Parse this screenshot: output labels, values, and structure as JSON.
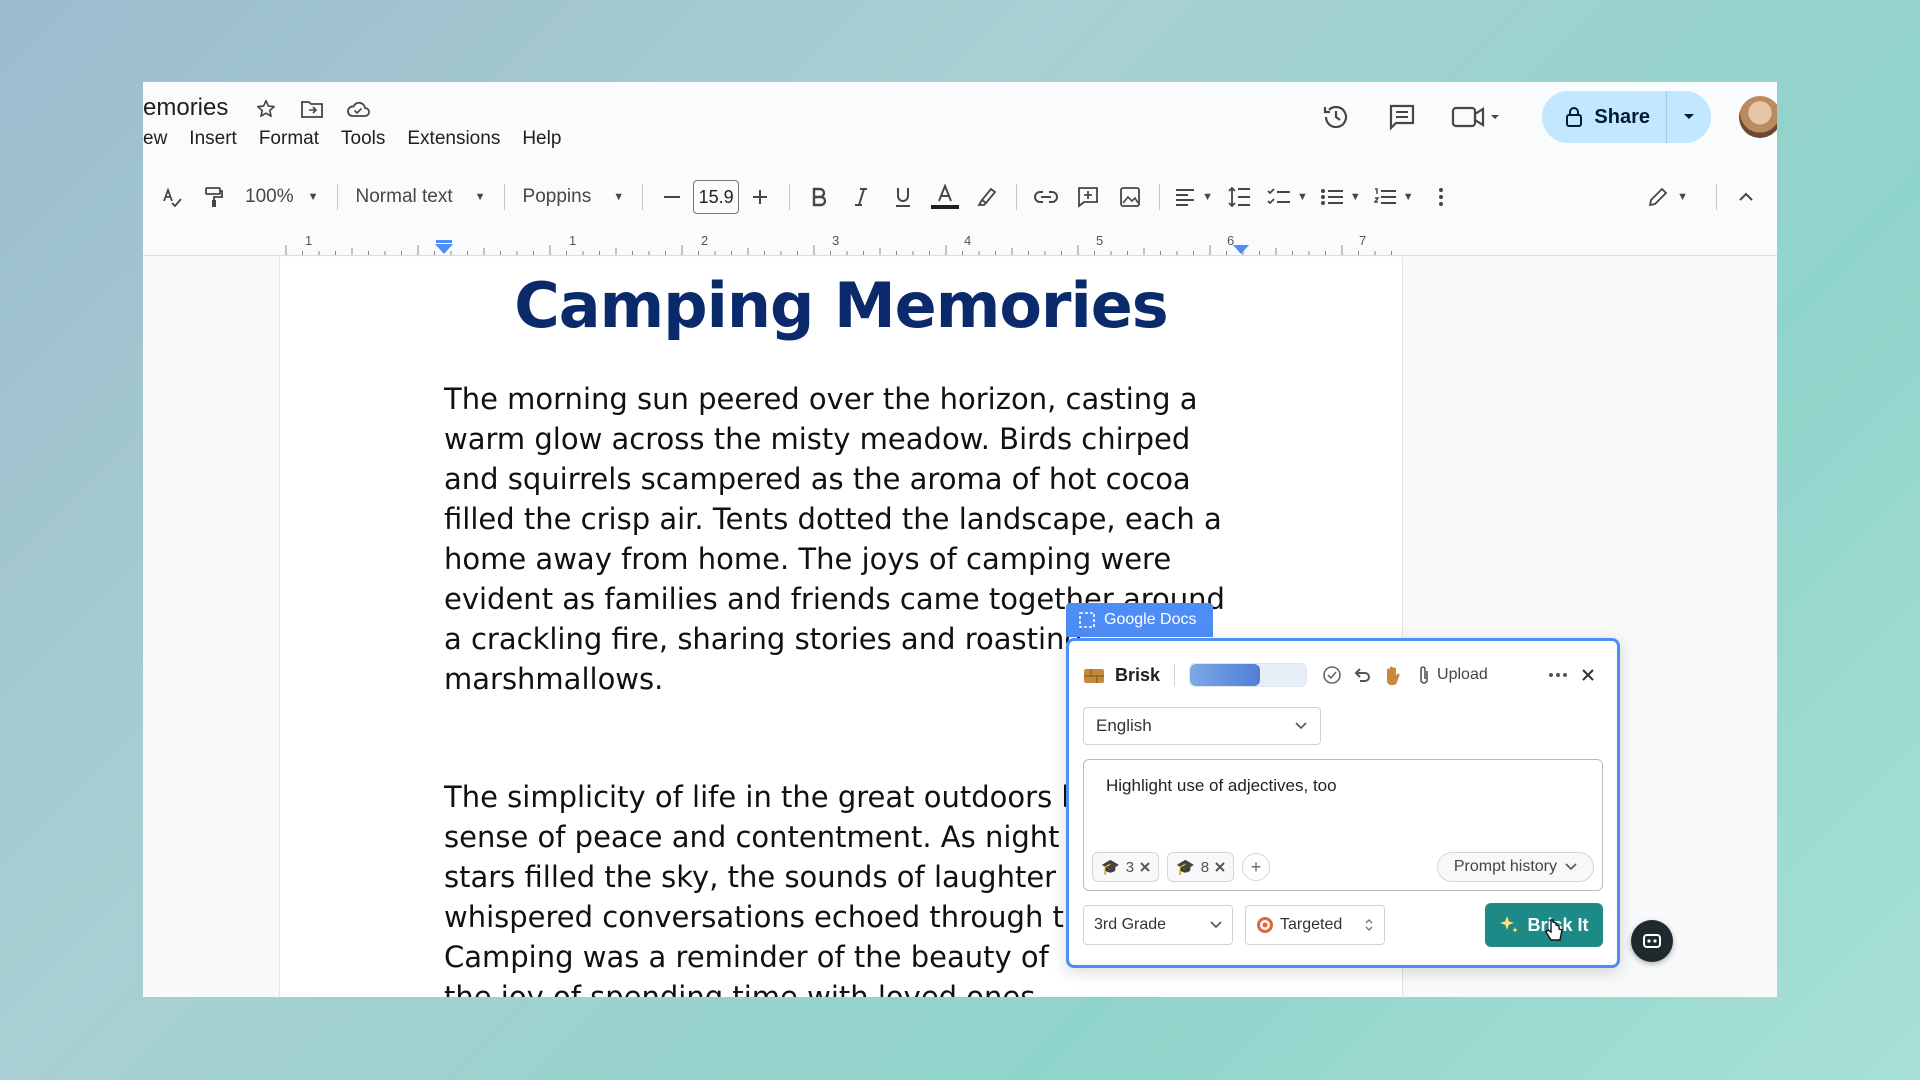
{
  "header": {
    "doc_title": "emories",
    "menu": [
      "ew",
      "Insert",
      "Format",
      "Tools",
      "Extensions",
      "Help"
    ],
    "share_label": "Share"
  },
  "toolbar": {
    "zoom": "100%",
    "style": "Normal text",
    "font": "Poppins",
    "font_size": "15.9"
  },
  "ruler": {
    "numbers": [
      "1",
      "1",
      "2",
      "3",
      "4",
      "5",
      "6",
      "7"
    ]
  },
  "document": {
    "title": "Camping Memories",
    "paragraphs": [
      [
        "The morning sun peered over the horizon, casting a",
        "warm glow across the misty meadow. Birds chirped",
        "and squirrels scampered as the aroma of hot cocoa",
        "filled the crisp air. Tents dotted the landscape, each a",
        "home away from home. The joys of camping were",
        "evident as families and friends came together around",
        "a crackling fire, sharing stories and roasting",
        "marshmallows."
      ],
      [
        "The simplicity of life in the great outdoors b",
        "sense of peace and contentment. As night",
        "stars filled the sky, the sounds of laughter a",
        "whispered conversations echoed through t",
        "Camping was a reminder of the beauty of",
        "the joy of spending time with loved ones."
      ]
    ]
  },
  "brisk": {
    "context_tag": "Google Docs",
    "name": "Brisk",
    "slider_level": 0.6,
    "upload_label": "Upload",
    "language": "English",
    "prompt": "Highlight use of adjectives, too",
    "chips": [
      "3",
      "8"
    ],
    "prompt_history_label": "Prompt history",
    "grade": "3rd Grade",
    "mode": "Targeted",
    "action_label": "Brisk It"
  },
  "colors": {
    "accent": "#4f8df6",
    "action": "#1e8a87",
    "title": "#0b2a6b",
    "share_bg": "#c2e7ff"
  }
}
